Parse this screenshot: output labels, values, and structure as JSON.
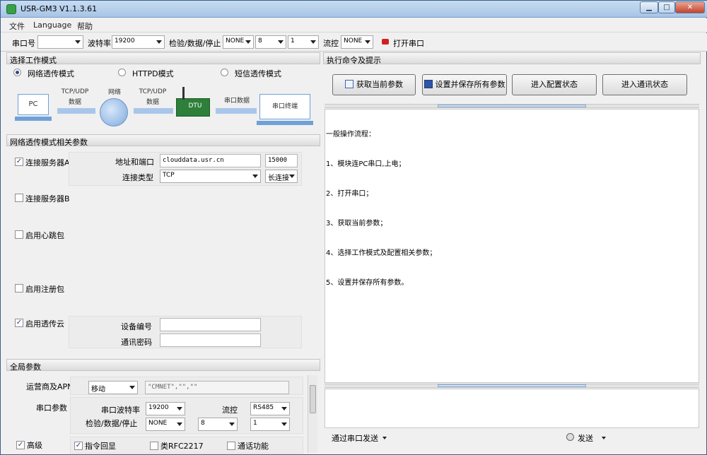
{
  "window": {
    "title": "USR-GM3 V1.1.3.61",
    "min": "▁",
    "max": "□",
    "close": "✕"
  },
  "menu": {
    "file": "文件",
    "language": "Language",
    "help": "帮助"
  },
  "toolbar": {
    "port_label": "串口号",
    "port_value": "",
    "baud_label": "波特率",
    "baud_value": "19200",
    "parity_label": "检验/数据/停止",
    "parity_value": "NONE",
    "databits_value": "8",
    "stopbits_value": "1",
    "flow_label": "流控",
    "flow_value": "NONE",
    "open_port_label": "打开串口",
    "open_port_color": "#d22020"
  },
  "mode_section": {
    "title": "选择工作模式",
    "modes": [
      "网络透传模式",
      "HTTPD模式",
      "短信透传模式"
    ],
    "selected": 0
  },
  "diagram": {
    "pc": "PC",
    "tcpudp1": "TCP/UDP",
    "data1": "数据",
    "network": "网络",
    "tcpudp2": "TCP/UDP",
    "data2": "数据",
    "dtu": "DTU",
    "serial_data": "串口数据",
    "serial_terminal": "串口终端"
  },
  "net_params": {
    "title": "网络透传模式相关参数",
    "server_a": {
      "label": "连接服务器A",
      "checked": "✓",
      "addr_label": "地址和端口",
      "host": "clouddata.usr.cn",
      "port": "15000",
      "type_label": "连接类型",
      "type_value": "TCP",
      "conn_value": "长连接"
    },
    "server_b": {
      "label": "连接服务器B"
    },
    "heartbeat": {
      "label": "启用心跳包"
    },
    "register": {
      "label": "启用注册包"
    },
    "cloud": {
      "label": "启用透传云",
      "checked": "✓",
      "device_id_label": "设备编号",
      "device_id": "",
      "password_label": "通讯密码",
      "password": ""
    }
  },
  "global": {
    "title": "全局参数",
    "apn_label": "运营商及APN",
    "carrier": "移动",
    "apn_value": "\"CMNET\",\"\",\"\"",
    "serial_label": "串口参数",
    "baud_label": "串口波特率",
    "baud_value": "19200",
    "flow_label": "流控",
    "flow_value": "RS485",
    "parity_label": "检验/数据/停止",
    "parity_value": "NONE",
    "databits_value": "8",
    "stopbits_value": "1",
    "advanced_label": "高级",
    "echo_label": "指令回显",
    "rfc_label": "类RFC2217",
    "call_label": "通话功能",
    "advanced_checked": "✓",
    "echo_checked": "✓"
  },
  "right": {
    "title": "执行命令及提示",
    "buttons": {
      "get": "获取当前参数",
      "save": "设置并保存所有参数",
      "config": "进入配置状态",
      "comm": "进入通讯状态"
    },
    "log_lines": [
      "一般操作流程：",
      "1、模块连PC串口,上电；",
      "2、打开串口；",
      "3、获取当前参数；",
      "4、选择工作模式及配置相关参数；",
      "5、设置并保存所有参数。"
    ],
    "send_via": "通过串口发送",
    "send": "发送"
  }
}
